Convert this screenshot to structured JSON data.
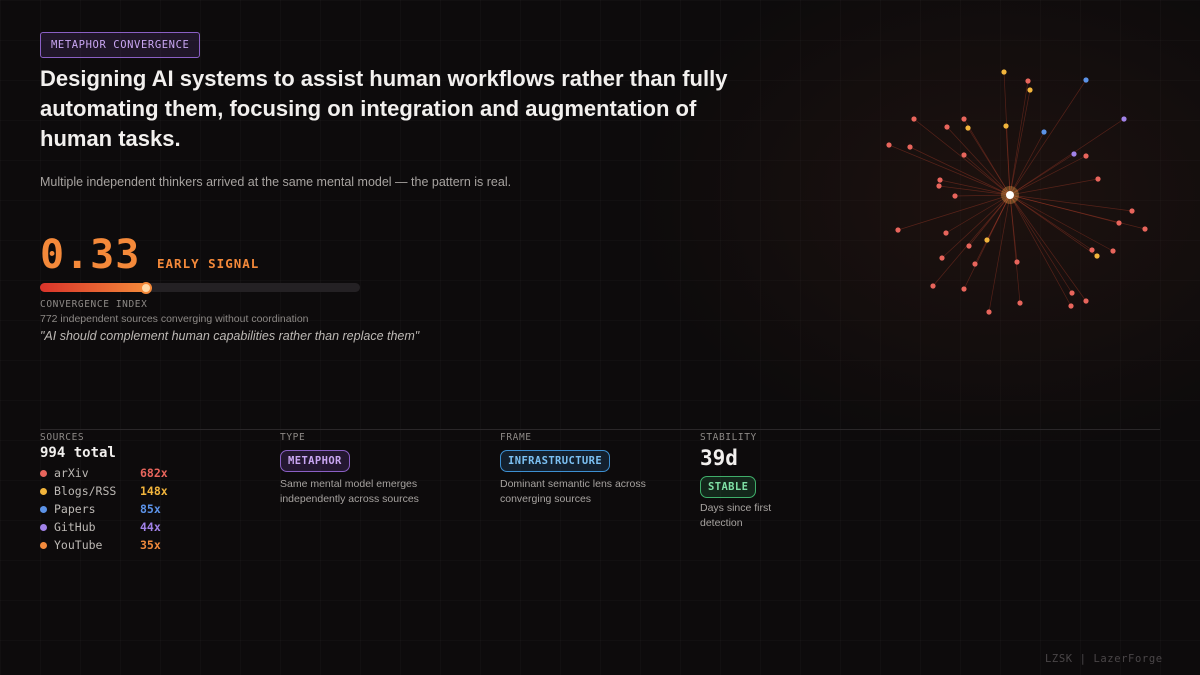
{
  "tag": "METAPHOR CONVERGENCE",
  "headline": "Designing AI systems to assist human workflows rather than fully automating them, focusing on integration and augmentation of human tasks.",
  "subline": "Multiple independent thinkers arrived at the same mental model — the pattern is real.",
  "score": {
    "value": "0.33",
    "fraction": 0.33,
    "signal_label": "EARLY SIGNAL",
    "index_label": "CONVERGENCE INDEX",
    "description": "772 independent sources converging without coordination",
    "quote": "\"AI should complement human capabilities rather than replace them\""
  },
  "sources": {
    "label": "SOURCES",
    "total": "994 total",
    "items": [
      {
        "name": "arXiv",
        "count": "682x",
        "color": "#e8655c"
      },
      {
        "name": "Blogs/RSS",
        "count": "148x",
        "color": "#f2b53c"
      },
      {
        "name": "Papers",
        "count": "85x",
        "color": "#5c93e8"
      },
      {
        "name": "GitHub",
        "count": "44x",
        "color": "#a182e8"
      },
      {
        "name": "YouTube",
        "count": "35x",
        "color": "#f28a3c"
      }
    ]
  },
  "type": {
    "label": "TYPE",
    "badge": "METAPHOR",
    "description": "Same mental model emerges independently across sources"
  },
  "frame": {
    "label": "FRAME",
    "badge": "INFRASTRUCTURE",
    "description": "Dominant semantic lens across converging sources"
  },
  "stability": {
    "label": "STABILITY",
    "value": "39d",
    "badge": "STABLE",
    "description": "Days since first detection"
  },
  "footer": "LZSK | LazerForge",
  "network": {
    "center_color": "#ffffff",
    "line_color": "#c8442d",
    "node_colors": [
      "#e8655c",
      "#f2b53c",
      "#5c93e8",
      "#a182e8"
    ]
  }
}
